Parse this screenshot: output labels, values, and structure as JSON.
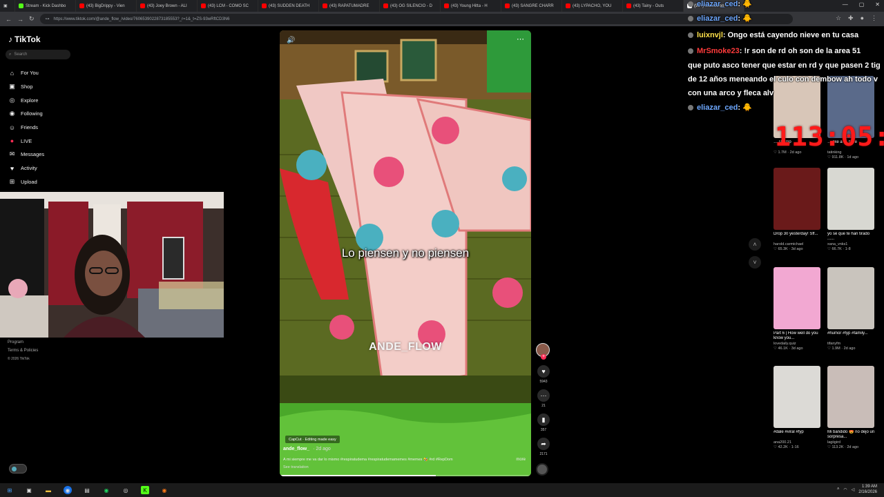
{
  "browser": {
    "tabs": [
      {
        "label": "Stream - Kick Dashbo",
        "color": "#53fc18"
      },
      {
        "label": "(43) BigDrippy - Vien",
        "color": "#ff0000"
      },
      {
        "label": "(43) Joey Brown - ALI",
        "color": "#ff0000"
      },
      {
        "label": "(43) LCM - COMO SC",
        "color": "#ff0000"
      },
      {
        "label": "(43) SUDDEN DEATH",
        "color": "#ff0000"
      },
      {
        "label": "(43) RAPATUMADRE",
        "color": "#ff0000"
      },
      {
        "label": "(43) OG SILENCIO - D",
        "color": "#ff0000"
      },
      {
        "label": "(43) Young Hitta - H",
        "color": "#ff0000"
      },
      {
        "label": "(43) SANGRE CHARR",
        "color": "#ff0000"
      },
      {
        "label": "(43) LYPACHO, YOU",
        "color": "#ff0000"
      },
      {
        "label": "(43) Tainy - Outs",
        "color": "#ff0000"
      },
      {
        "label": "(99+) Memes so",
        "color": "#ffffff"
      }
    ],
    "url": "https://www.tiktok.com/@ande_flow_/video/7606539022873185553?_r=1&_t=ZS-93wRftCD3N6"
  },
  "sidebar": {
    "logo": "TikTok",
    "search_placeholder": "Search",
    "items": [
      {
        "label": "For You",
        "icon": "home-icon",
        "glyph": "⌂"
      },
      {
        "label": "Shop",
        "icon": "shop-icon",
        "glyph": "▣"
      },
      {
        "label": "Explore",
        "icon": "explore-icon",
        "glyph": "◎"
      },
      {
        "label": "Following",
        "icon": "following-icon",
        "glyph": "◉"
      },
      {
        "label": "Friends",
        "icon": "friends-icon",
        "glyph": "☺"
      },
      {
        "label": "LIVE",
        "icon": "live-icon",
        "glyph": "●"
      },
      {
        "label": "Messages",
        "icon": "messages-icon",
        "glyph": "✉"
      },
      {
        "label": "Activity",
        "icon": "activity-icon",
        "glyph": "♥"
      },
      {
        "label": "Upload",
        "icon": "upload-icon",
        "glyph": "⊞"
      }
    ],
    "footer": {
      "program": "Program",
      "terms": "Terms & Policies",
      "copyright": "© 2026 TikTok"
    }
  },
  "video": {
    "caption": "Lo piensen y no piensen",
    "watermark": "ANDE_FLOW",
    "capcut_badge": "CapCut · Editing made easy",
    "author": "ande_flow_",
    "date": "· 2d ago",
    "description": "A mi siempre me va dar lo mismo #respiratudema #respiratudemamemes #memes 🤣 #rd #RepDom",
    "more_label": "more",
    "see_translation": "See translation",
    "progress": 0.62
  },
  "actions": {
    "likes": "5943",
    "comments": "21",
    "saves": "357",
    "shares": "2171"
  },
  "chat": [
    {
      "user": "eliazar_ced",
      "user_color": "#6ea8ff",
      "text": ": 🐥"
    },
    {
      "user": "eliazar_ced",
      "user_color": "#6ea8ff",
      "text": ": 🐥"
    },
    {
      "user": "luixnvjl",
      "user_color": "#ffe14a",
      "text": ": Ongo está cayendo nieve en tu casa"
    },
    {
      "user": "MrSmoke23",
      "user_color": "#ff3b3b",
      "text": ": !r son de rd oh son de la area 51"
    },
    {
      "user": "",
      "user_color": "#ffffff",
      "text": "que puto asco tener que estar en rd y que pasen 2 tig"
    },
    {
      "user": "",
      "user_color": "#ffffff",
      "text": "de 12 años meneando el culo con dembow ah todo v"
    },
    {
      "user": "",
      "user_color": "#ffffff",
      "text": "con una arco y fleca alv"
    },
    {
      "user": "eliazar_ced",
      "user_color": "#6ea8ff",
      "text": ": 🐥"
    }
  ],
  "timer": "113:05:15",
  "recommendations": [
    {
      "title": "… shrimp",
      "author": "",
      "meta": "♡ 1.7M · 2d ago",
      "color": "#d8c6b8"
    },
    {
      "title": "… like a … here",
      "author": "tatinking",
      "meta": "♡ 911.8K · 1d ago",
      "color": "#5a6a8a"
    },
    {
      "title": "Drop 30 yesterday! Sff...",
      "author": "harold.carmichael",
      "meta": "♡ 65.3K · 3d ago",
      "color": "#6a1a1a"
    },
    {
      "title": "yo sé que te han tirado ......",
      "author": "xana_vnks1",
      "meta": "♡ 66.7K · 1-8",
      "color": "#d8d8d2"
    },
    {
      "title": "Part 6 | How well do you know you...",
      "author": "lovedaily.quiz",
      "meta": "♡ 46.1K · 3d ago",
      "color": "#f2a8d2"
    },
    {
      "title": "#humor #fyp #family...",
      "author": "tifanyfm",
      "meta": "♡ 1.9M · 2d ago",
      "color": "#c9c4bd"
    },
    {
      "title": "#dale #viral #fyp",
      "author": "ana200.21",
      "meta": "♡ 42.2K · 1-16",
      "color": "#dcdad6"
    },
    {
      "title": "Mi bandido 😍 no dejo un sorpresa...",
      "author": "lagiigird",
      "meta": "♡ 113.2K · 2d ago",
      "color": "#c9bdb8"
    }
  ],
  "system": {
    "time": "1:39 AM",
    "date": "2/16/2026"
  }
}
